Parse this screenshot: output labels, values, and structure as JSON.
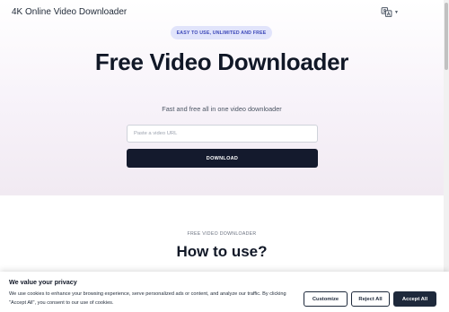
{
  "header": {
    "brand": "4K Online Video Downloader",
    "language_icon": "translate-icon"
  },
  "hero": {
    "badge": "EASY TO USE, UNLIMITED AND FREE",
    "title": "Free Video Downloader",
    "subtitle": "Fast and free all in one video downloader",
    "input_placeholder": "Paste a video URL",
    "input_value": "",
    "download_label": "DOWNLOAD"
  },
  "how_to": {
    "eyebrow": "FREE VIDEO DOWNLOADER",
    "title": "How to use?"
  },
  "cookie": {
    "title": "We value your privacy",
    "text": "We use cookies to enhance your browsing experience, serve personalized ads or content, and analyze our traffic. By clicking \"Accept All\", you consent to our use of cookies.",
    "customize_label": "Customize",
    "reject_label": "Reject All",
    "accept_label": "Accept All"
  },
  "colors": {
    "primary_button": "#141a2d",
    "badge_bg": "#e1e4fb",
    "badge_text": "#3b47b8",
    "hero_bg": "#f4eef5"
  }
}
